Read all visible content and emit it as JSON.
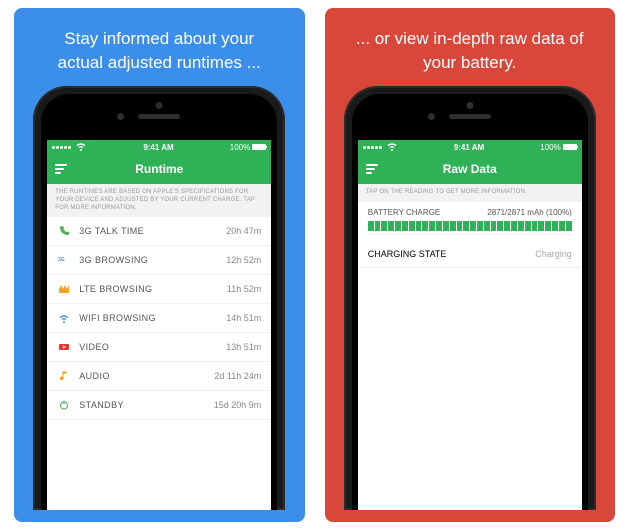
{
  "colors": {
    "blue": "#3b8eea",
    "red": "#d9463a",
    "green": "#2fb257"
  },
  "statusbar": {
    "carrier": "",
    "time": "9:41 AM",
    "battery_pct": "100%"
  },
  "left": {
    "headline": "Stay informed about your actual adjusted runtimes ...",
    "nav_title": "Runtime",
    "hint": "THE RUNTIMES ARE BASED ON APPLE'S SPECIFICATIONS FOR YOUR DEVICE AND ADJUSTED BY YOUR CURRENT CHARGE. TAP FOR MORE INFORMATION.",
    "rows": [
      {
        "icon": "phone",
        "label": "3G TALK TIME",
        "value": "20h 47m"
      },
      {
        "icon": "3g",
        "label": "3G BROWSING",
        "value": "12h 52m"
      },
      {
        "icon": "lte",
        "label": "LTE BROWSING",
        "value": "11h 52m"
      },
      {
        "icon": "wifi",
        "label": "WIFI BROWSING",
        "value": "14h 51m"
      },
      {
        "icon": "video",
        "label": "VIDEO",
        "value": "13h 51m"
      },
      {
        "icon": "audio",
        "label": "AUDIO",
        "value": "2d 11h 24m"
      },
      {
        "icon": "standby",
        "label": "STANDBY",
        "value": "15d 20h 9m"
      }
    ]
  },
  "right": {
    "headline": "... or view in-depth raw data of your battery.",
    "nav_title": "Raw Data",
    "hint": "TAP ON THE READING TO GET MORE INFORMATION.",
    "battery_row": {
      "label": "BATTERY CHARGE",
      "value": "2871/2871 mAh (100%)"
    },
    "charging_row": {
      "label": "CHARGING STATE",
      "value": "Charging"
    }
  }
}
